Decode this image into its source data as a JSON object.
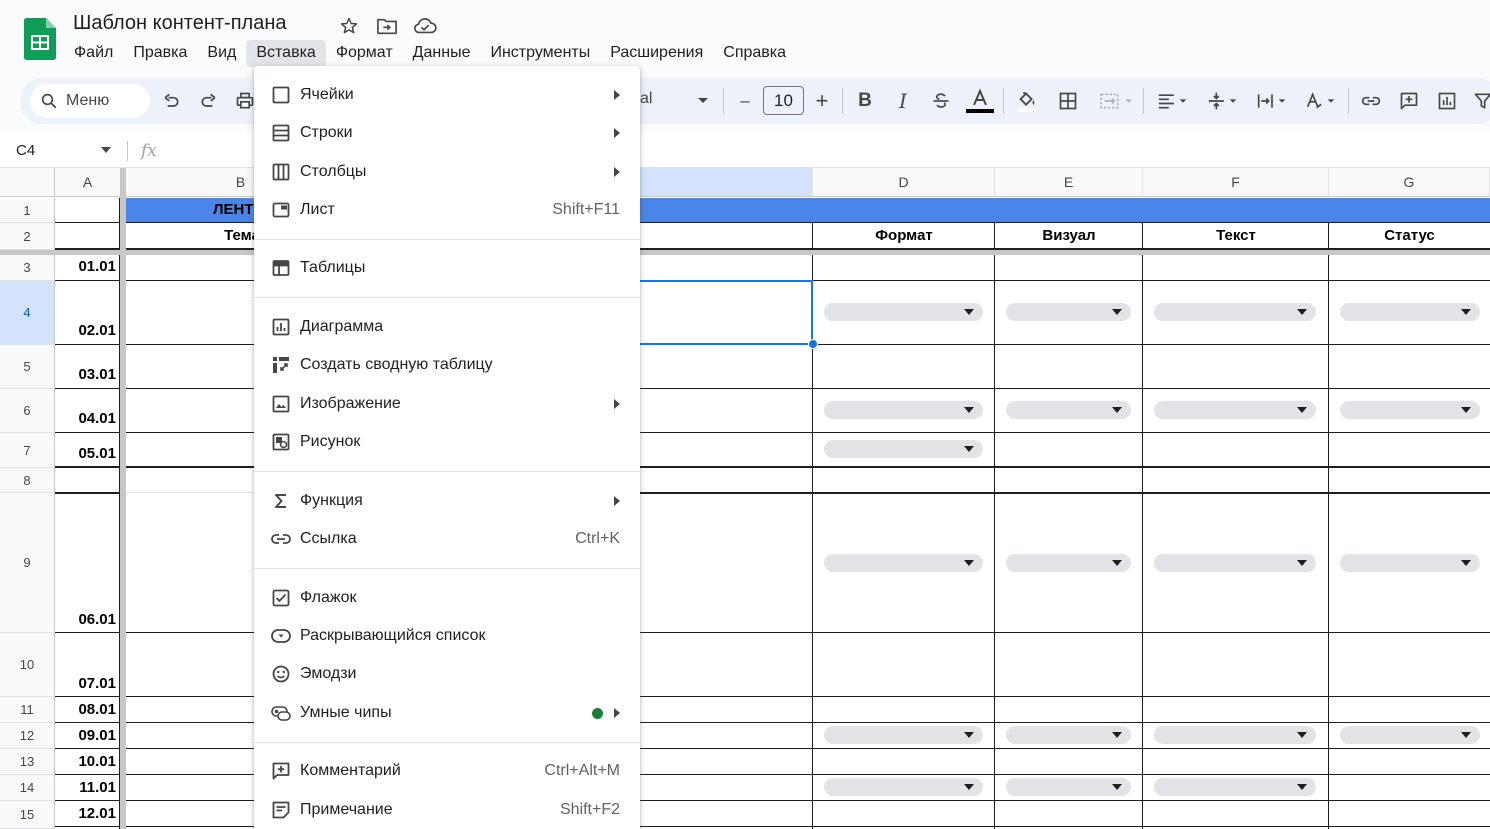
{
  "app": {
    "title": "Шаблон контент-плана",
    "menu": [
      "Файл",
      "Правка",
      "Вид",
      "Вставка",
      "Формат",
      "Данные",
      "Инструменты",
      "Расширения",
      "Справка"
    ],
    "active_menu": "Вставка"
  },
  "toolbar": {
    "search_label": "Меню",
    "font_name": "al",
    "font_size": "10",
    "minus": "–",
    "plus": "+"
  },
  "formula_bar": {
    "cell_ref": "C4",
    "fx": "fx"
  },
  "grid": {
    "columns": [
      "A",
      "B",
      "D",
      "E",
      "F",
      "G"
    ],
    "rows": [
      "1",
      "2",
      "3",
      "4",
      "5",
      "6",
      "7",
      "8",
      "9",
      "10",
      "11",
      "12",
      "13",
      "14",
      "15"
    ],
    "header_band_text": "ЛЕНТ",
    "header_row": {
      "b": "Тема",
      "d": "Формат",
      "e": "Визуал",
      "f": "Текст",
      "g": "Статус"
    },
    "dates": [
      "01.01",
      "02.01",
      "03.01",
      "04.01",
      "05.01",
      "06.01",
      "07.01",
      "08.01",
      "09.01",
      "10.01",
      "11.01",
      "12.01"
    ]
  },
  "insert_menu": {
    "items": [
      {
        "label": "Ячейки",
        "icon": "cell-icon",
        "submenu": true
      },
      {
        "label": "Строки",
        "icon": "rows-icon",
        "submenu": true
      },
      {
        "label": "Столбцы",
        "icon": "columns-icon",
        "submenu": true
      },
      {
        "label": "Лист",
        "icon": "sheet-icon",
        "shortcut": "Shift+F11"
      },
      {
        "label": "Таблицы",
        "icon": "table-icon"
      },
      {
        "label": "Диаграмма",
        "icon": "chart-icon"
      },
      {
        "label": "Создать сводную таблицу",
        "icon": "pivot-icon"
      },
      {
        "label": "Изображение",
        "icon": "image-icon",
        "submenu": true
      },
      {
        "label": "Рисунок",
        "icon": "drawing-icon"
      },
      {
        "label": "Функция",
        "icon": "sigma-icon",
        "submenu": true
      },
      {
        "label": "Ссылка",
        "icon": "link-icon",
        "shortcut": "Ctrl+K"
      },
      {
        "label": "Флажок",
        "icon": "checkbox-icon"
      },
      {
        "label": "Раскрывающийся список",
        "icon": "dropdown-icon"
      },
      {
        "label": "Эмодзи",
        "icon": "emoji-icon"
      },
      {
        "label": "Умные чипы",
        "icon": "smart-chip-icon",
        "submenu": true,
        "new_dot": true
      },
      {
        "label": "Комментарий",
        "icon": "comment-icon",
        "shortcut": "Ctrl+Alt+M"
      },
      {
        "label": "Примечание",
        "icon": "note-icon",
        "shortcut": "Shift+F2"
      }
    ]
  },
  "colors": {
    "accent": "#1a73e8",
    "header_band": "#4a86e8",
    "new_dot": "#188038",
    "sheets_green": "#0f9d58"
  }
}
